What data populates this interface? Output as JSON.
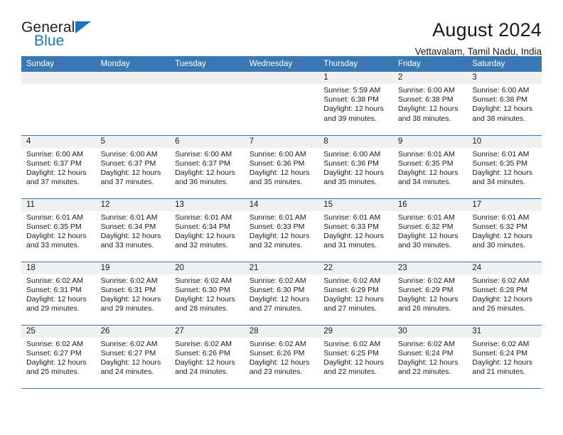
{
  "brand": {
    "line1": "General",
    "line2": "Blue",
    "flag_icon": "triangle-flag-icon",
    "accent_color": "#1b75bc"
  },
  "header": {
    "title": "August 2024",
    "subtitle": "Vettavalam, Tamil Nadu, India"
  },
  "theme": {
    "header_blue": "#3a78b5",
    "daynum_strip": "#f0f0f0",
    "text": "#1a1a1a"
  },
  "calendar": {
    "weekday_headers": [
      "Sunday",
      "Monday",
      "Tuesday",
      "Wednesday",
      "Thursday",
      "Friday",
      "Saturday"
    ],
    "weeks": [
      [
        {
          "day": "",
          "lines": []
        },
        {
          "day": "",
          "lines": []
        },
        {
          "day": "",
          "lines": []
        },
        {
          "day": "",
          "lines": []
        },
        {
          "day": "1",
          "lines": [
            "Sunrise: 5:59 AM",
            "Sunset: 6:38 PM",
            "Daylight: 12 hours",
            "and 39 minutes."
          ]
        },
        {
          "day": "2",
          "lines": [
            "Sunrise: 6:00 AM",
            "Sunset: 6:38 PM",
            "Daylight: 12 hours",
            "and 38 minutes."
          ]
        },
        {
          "day": "3",
          "lines": [
            "Sunrise: 6:00 AM",
            "Sunset: 6:38 PM",
            "Daylight: 12 hours",
            "and 38 minutes."
          ]
        }
      ],
      [
        {
          "day": "4",
          "lines": [
            "Sunrise: 6:00 AM",
            "Sunset: 6:37 PM",
            "Daylight: 12 hours",
            "and 37 minutes."
          ]
        },
        {
          "day": "5",
          "lines": [
            "Sunrise: 6:00 AM",
            "Sunset: 6:37 PM",
            "Daylight: 12 hours",
            "and 37 minutes."
          ]
        },
        {
          "day": "6",
          "lines": [
            "Sunrise: 6:00 AM",
            "Sunset: 6:37 PM",
            "Daylight: 12 hours",
            "and 36 minutes."
          ]
        },
        {
          "day": "7",
          "lines": [
            "Sunrise: 6:00 AM",
            "Sunset: 6:36 PM",
            "Daylight: 12 hours",
            "and 35 minutes."
          ]
        },
        {
          "day": "8",
          "lines": [
            "Sunrise: 6:00 AM",
            "Sunset: 6:36 PM",
            "Daylight: 12 hours",
            "and 35 minutes."
          ]
        },
        {
          "day": "9",
          "lines": [
            "Sunrise: 6:01 AM",
            "Sunset: 6:35 PM",
            "Daylight: 12 hours",
            "and 34 minutes."
          ]
        },
        {
          "day": "10",
          "lines": [
            "Sunrise: 6:01 AM",
            "Sunset: 6:35 PM",
            "Daylight: 12 hours",
            "and 34 minutes."
          ]
        }
      ],
      [
        {
          "day": "11",
          "lines": [
            "Sunrise: 6:01 AM",
            "Sunset: 6:35 PM",
            "Daylight: 12 hours",
            "and 33 minutes."
          ]
        },
        {
          "day": "12",
          "lines": [
            "Sunrise: 6:01 AM",
            "Sunset: 6:34 PM",
            "Daylight: 12 hours",
            "and 33 minutes."
          ]
        },
        {
          "day": "13",
          "lines": [
            "Sunrise: 6:01 AM",
            "Sunset: 6:34 PM",
            "Daylight: 12 hours",
            "and 32 minutes."
          ]
        },
        {
          "day": "14",
          "lines": [
            "Sunrise: 6:01 AM",
            "Sunset: 6:33 PM",
            "Daylight: 12 hours",
            "and 32 minutes."
          ]
        },
        {
          "day": "15",
          "lines": [
            "Sunrise: 6:01 AM",
            "Sunset: 6:33 PM",
            "Daylight: 12 hours",
            "and 31 minutes."
          ]
        },
        {
          "day": "16",
          "lines": [
            "Sunrise: 6:01 AM",
            "Sunset: 6:32 PM",
            "Daylight: 12 hours",
            "and 30 minutes."
          ]
        },
        {
          "day": "17",
          "lines": [
            "Sunrise: 6:01 AM",
            "Sunset: 6:32 PM",
            "Daylight: 12 hours",
            "and 30 minutes."
          ]
        }
      ],
      [
        {
          "day": "18",
          "lines": [
            "Sunrise: 6:02 AM",
            "Sunset: 6:31 PM",
            "Daylight: 12 hours",
            "and 29 minutes."
          ]
        },
        {
          "day": "19",
          "lines": [
            "Sunrise: 6:02 AM",
            "Sunset: 6:31 PM",
            "Daylight: 12 hours",
            "and 29 minutes."
          ]
        },
        {
          "day": "20",
          "lines": [
            "Sunrise: 6:02 AM",
            "Sunset: 6:30 PM",
            "Daylight: 12 hours",
            "and 28 minutes."
          ]
        },
        {
          "day": "21",
          "lines": [
            "Sunrise: 6:02 AM",
            "Sunset: 6:30 PM",
            "Daylight: 12 hours",
            "and 27 minutes."
          ]
        },
        {
          "day": "22",
          "lines": [
            "Sunrise: 6:02 AM",
            "Sunset: 6:29 PM",
            "Daylight: 12 hours",
            "and 27 minutes."
          ]
        },
        {
          "day": "23",
          "lines": [
            "Sunrise: 6:02 AM",
            "Sunset: 6:29 PM",
            "Daylight: 12 hours",
            "and 26 minutes."
          ]
        },
        {
          "day": "24",
          "lines": [
            "Sunrise: 6:02 AM",
            "Sunset: 6:28 PM",
            "Daylight: 12 hours",
            "and 26 minutes."
          ]
        }
      ],
      [
        {
          "day": "25",
          "lines": [
            "Sunrise: 6:02 AM",
            "Sunset: 6:27 PM",
            "Daylight: 12 hours",
            "and 25 minutes."
          ]
        },
        {
          "day": "26",
          "lines": [
            "Sunrise: 6:02 AM",
            "Sunset: 6:27 PM",
            "Daylight: 12 hours",
            "and 24 minutes."
          ]
        },
        {
          "day": "27",
          "lines": [
            "Sunrise: 6:02 AM",
            "Sunset: 6:26 PM",
            "Daylight: 12 hours",
            "and 24 minutes."
          ]
        },
        {
          "day": "28",
          "lines": [
            "Sunrise: 6:02 AM",
            "Sunset: 6:26 PM",
            "Daylight: 12 hours",
            "and 23 minutes."
          ]
        },
        {
          "day": "29",
          "lines": [
            "Sunrise: 6:02 AM",
            "Sunset: 6:25 PM",
            "Daylight: 12 hours",
            "and 22 minutes."
          ]
        },
        {
          "day": "30",
          "lines": [
            "Sunrise: 6:02 AM",
            "Sunset: 6:24 PM",
            "Daylight: 12 hours",
            "and 22 minutes."
          ]
        },
        {
          "day": "31",
          "lines": [
            "Sunrise: 6:02 AM",
            "Sunset: 6:24 PM",
            "Daylight: 12 hours",
            "and 21 minutes."
          ]
        }
      ]
    ]
  }
}
